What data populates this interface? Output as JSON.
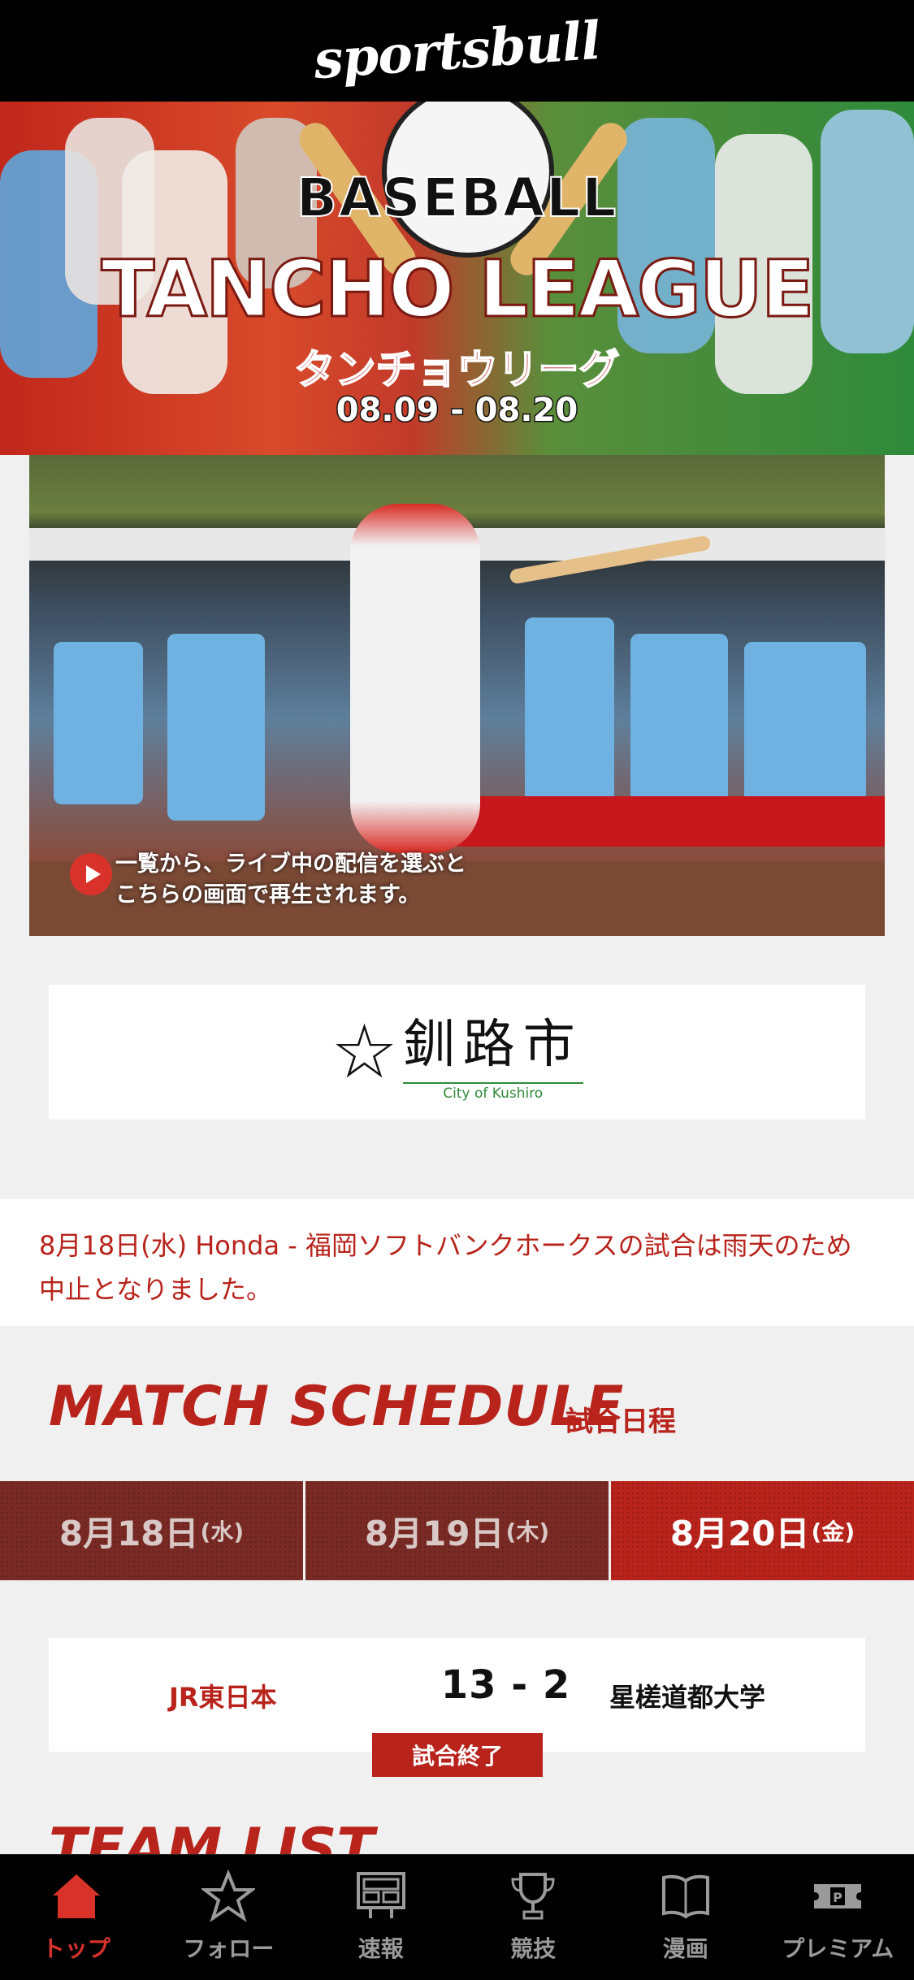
{
  "header": {
    "logo_text": "sportsbull"
  },
  "banner": {
    "line1": "BASEBALL",
    "title": "TANCHO LEAGUE",
    "kana": "タンチョウリーグ",
    "dates": "08.09 - 08.20"
  },
  "video": {
    "hint": "一覧から、ライブ中の配信を選ぶと\nこちらの画面で再生されます。"
  },
  "sponsor": {
    "name": "釧路市",
    "sub": "City of Kushiro"
  },
  "notice": {
    "text": "8月18日(水) Honda - 福岡ソフトバンクホークスの試合は雨天のため中止となりました。"
  },
  "schedule": {
    "title": "MATCH SCHEDULE",
    "subtitle": "試合日程",
    "tabs": [
      {
        "date": "8月18日",
        "day": "(水)"
      },
      {
        "date": "8月19日",
        "day": "(木)"
      },
      {
        "date": "8月20日",
        "day": "(金)"
      }
    ],
    "active_tab": 2,
    "match": {
      "home": "JR東日本",
      "score": "13 - 2",
      "away": "星槎道都大学",
      "status": "試合終了"
    }
  },
  "team_list_title": "TEAM LIST",
  "tabbar": {
    "items": [
      {
        "label": "トップ",
        "icon": "home-icon"
      },
      {
        "label": "フォロー",
        "icon": "star-icon"
      },
      {
        "label": "速報",
        "icon": "scoreboard-icon"
      },
      {
        "label": "競技",
        "icon": "trophy-icon"
      },
      {
        "label": "漫画",
        "icon": "book-icon"
      },
      {
        "label": "プレミアム",
        "icon": "ticket-icon"
      }
    ]
  },
  "colors": {
    "accent": "#b8231b",
    "tabbar_active": "#d8322b"
  }
}
